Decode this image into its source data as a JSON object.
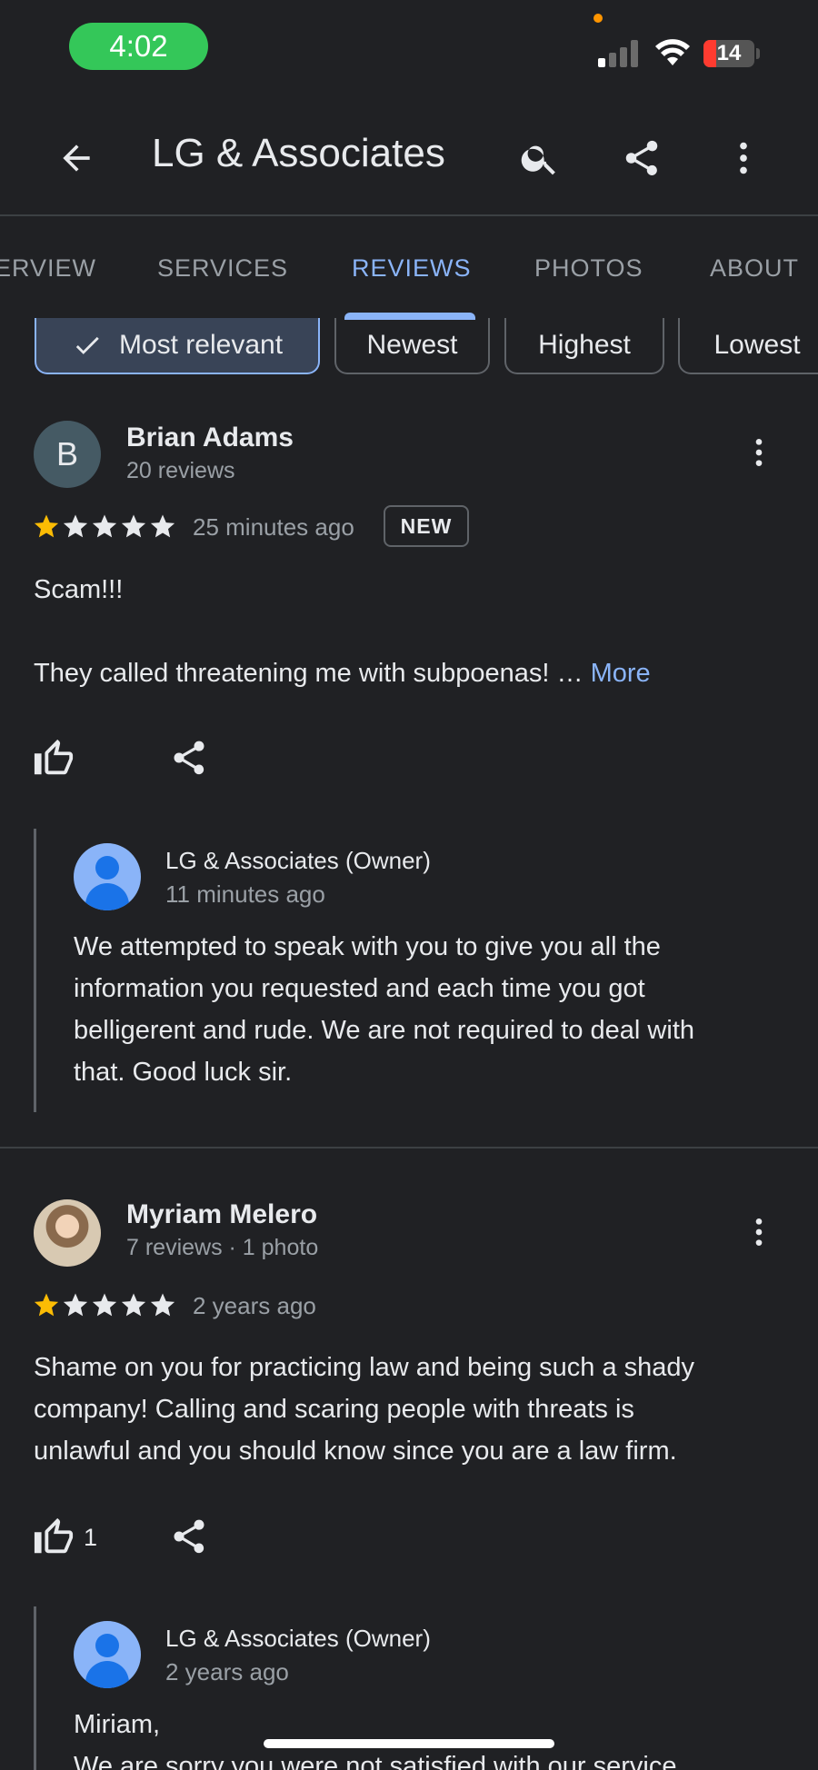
{
  "status_bar": {
    "time": "4:02",
    "battery": "14",
    "colors": {
      "time_pill": "#34c759",
      "battery_low": "#ff3b30"
    }
  },
  "app_bar": {
    "title": "LG & Associates",
    "icons": [
      "arrow-back-icon",
      "search-icon",
      "share-icon",
      "more-vert-icon"
    ]
  },
  "tabs": [
    {
      "label": "ERVIEW"
    },
    {
      "label": "SERVICES"
    },
    {
      "label": "REVIEWS",
      "active": true
    },
    {
      "label": "PHOTOS"
    },
    {
      "label": "ABOUT"
    }
  ],
  "filters": {
    "selected": "Most relevant",
    "chips": [
      "Most relevant",
      "Newest",
      "Highest",
      "Lowest"
    ]
  },
  "reviews": [
    {
      "avatar_letter": "B",
      "name": "Brian Adams",
      "meta": "20 reviews",
      "rating": 1,
      "date": "25 minutes ago",
      "badge": "NEW",
      "text_line1": "Scam!!!",
      "text_line2": "They called threatening me with subpoenas! …",
      "more": "More",
      "likes": "",
      "reply": {
        "name": "LG & Associates (Owner)",
        "date": "11 minutes ago",
        "lines": [
          "We attempted to speak with you to give you all the",
          "information you requested and each time you got",
          "belligerent and rude. We are not required to deal with",
          "that. Good luck sir."
        ]
      }
    },
    {
      "name": "Myriam Melero",
      "meta": "7 reviews · 1 photo",
      "rating": 1,
      "date": "2 years ago",
      "lines": [
        "Shame on you for practicing law and being such a shady",
        "company! Calling and scaring people with threats is",
        "unlawful and you should know since you are a law firm."
      ],
      "likes": "1",
      "reply": {
        "name": "LG & Associates (Owner)",
        "date": "2 years ago",
        "lines": [
          "Miriam,",
          "We are sorry you were not satisfied with our service"
        ]
      }
    }
  ],
  "colors": {
    "accent": "#8ab4f8",
    "star": "#fbbc04",
    "star_empty": "#e8eaed",
    "background": "#202124"
  }
}
